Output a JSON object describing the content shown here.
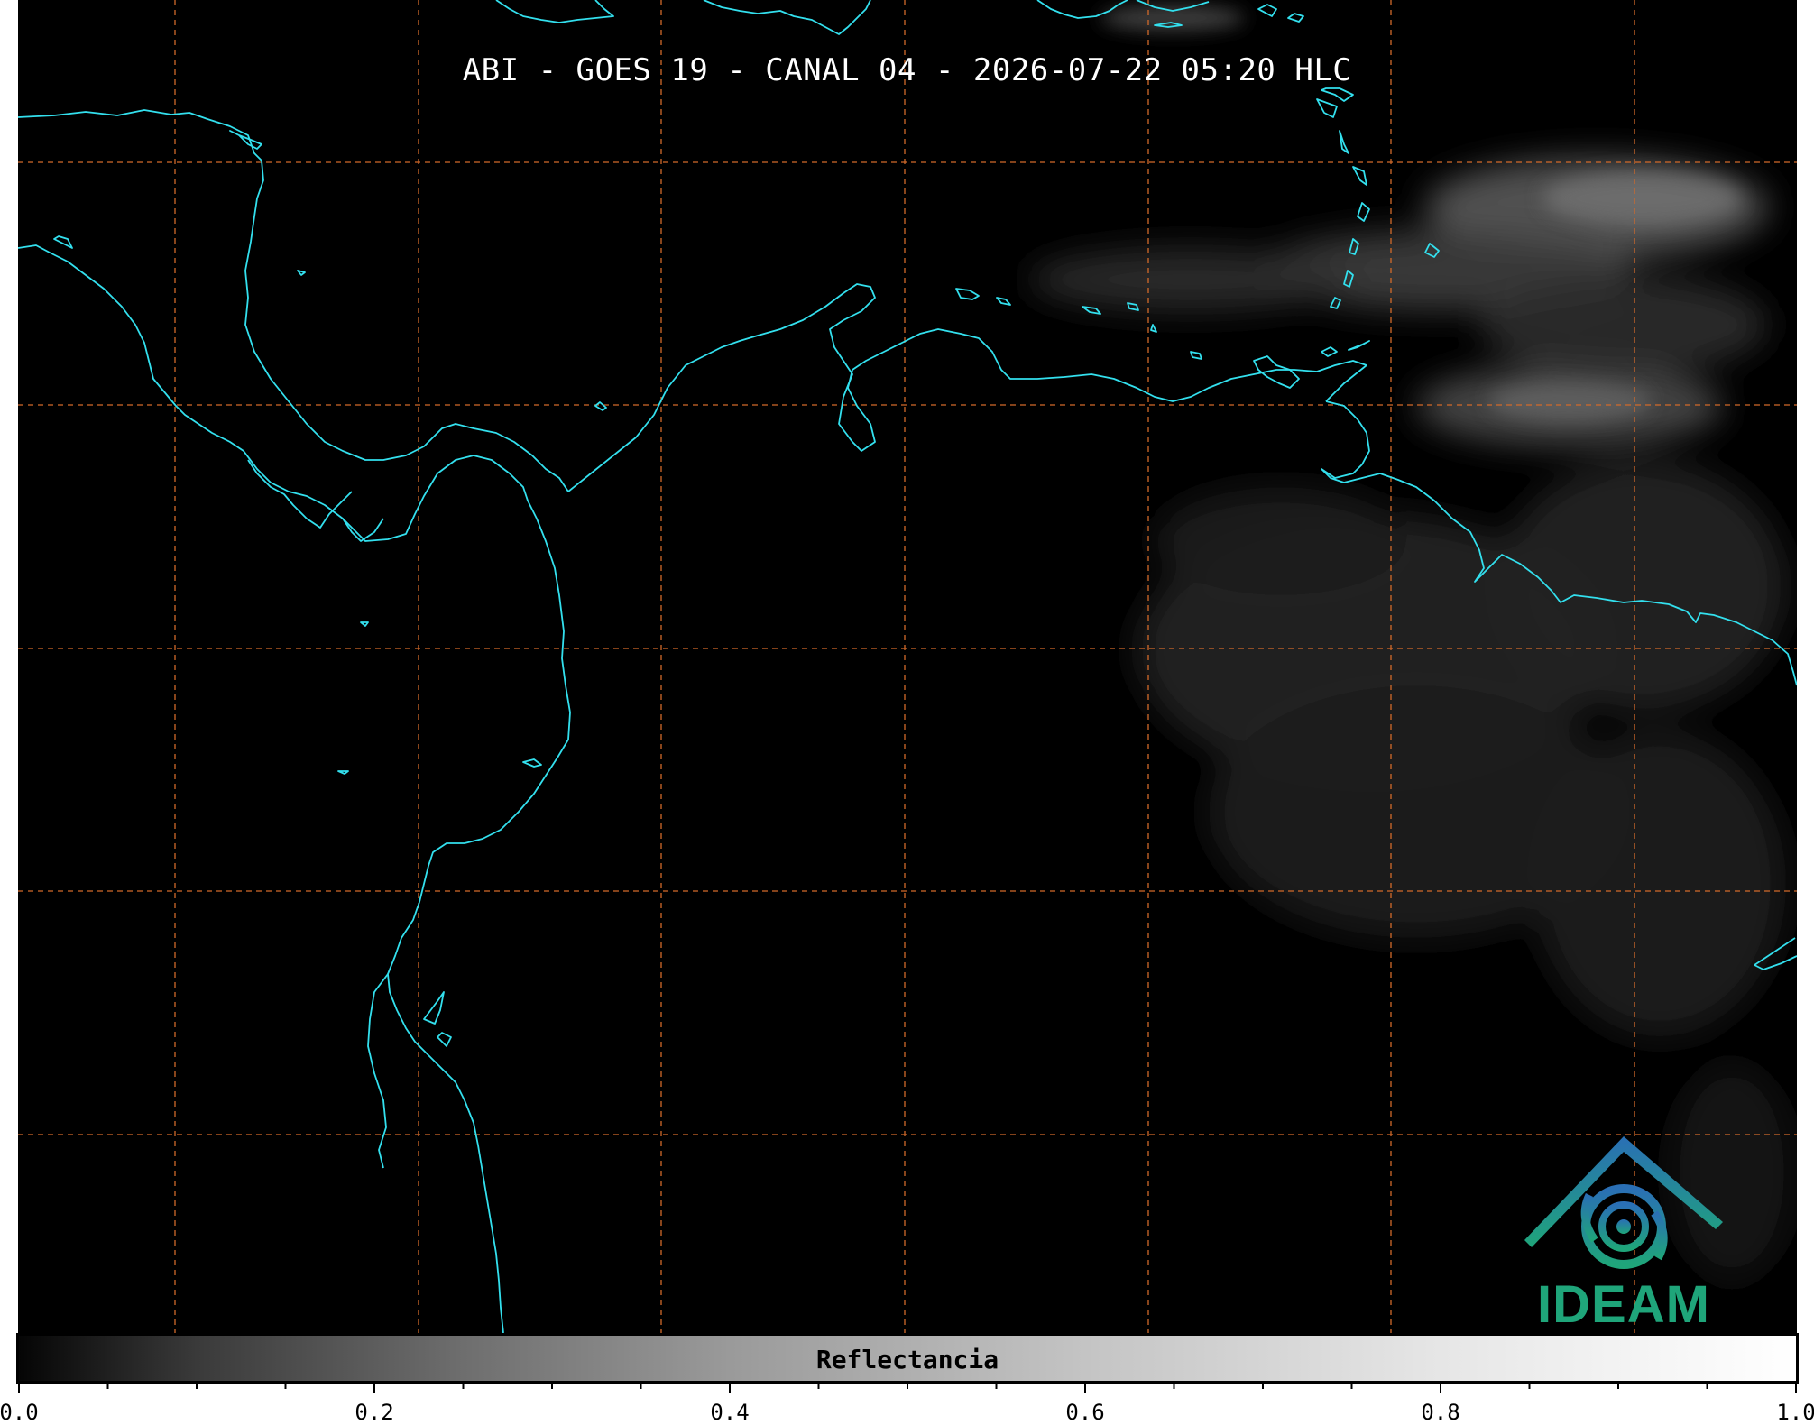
{
  "title": "ABI - GOES 19 - CANAL 04 - 2026-07-22 05:20 HLC",
  "colorbar": {
    "label": "Reflectancia",
    "range": [
      0.0,
      1.0
    ],
    "tick_labels": [
      "0.0",
      "0.2",
      "0.4",
      "0.6",
      "0.8",
      "1.0"
    ],
    "colors": [
      "#050505",
      "#ffffff"
    ]
  },
  "map": {
    "background": "#000000",
    "coastline_color": "#33e0ee",
    "gridline_color": "#d26a2a",
    "gridline_style": "dashed",
    "cloud_region": "east"
  },
  "logo": {
    "text": "IDEAM",
    "colors": [
      "#2a6fb5",
      "#1fa57a"
    ]
  }
}
